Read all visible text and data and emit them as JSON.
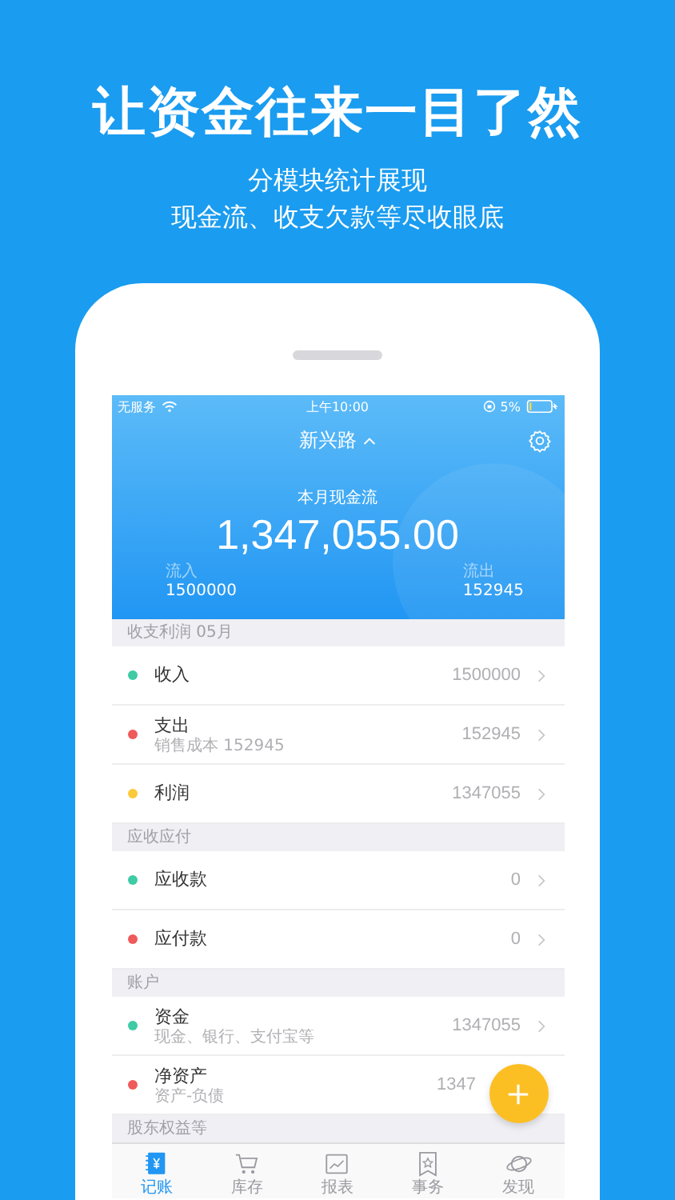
{
  "headline": "让资金往来一目了然",
  "subtitle": [
    "分模块统计展现",
    "现金流、收支欠款等尽收眼底"
  ],
  "status_bar": {
    "carrier": "无服务",
    "time": "上午10:00",
    "battery": "5%"
  },
  "header": {
    "title": "新兴路",
    "caption": "本月现金流",
    "amount": "1,347,055.00",
    "inflow": {
      "label": "流入",
      "value": "1500000"
    },
    "outflow": {
      "label": "流出",
      "value": "152945"
    }
  },
  "sections": [
    {
      "title": "收支利润 05月",
      "rows": [
        {
          "title": "收入",
          "value": "1500000",
          "color": "#3ecba5"
        },
        {
          "title": "支出",
          "subtitle": "销售成本 152945",
          "value": "152945",
          "color": "#f05a5a"
        },
        {
          "title": "利润",
          "value": "1347055",
          "color": "#fcc93a"
        }
      ]
    },
    {
      "title": "应收应付",
      "rows": [
        {
          "title": "应收款",
          "value": "0",
          "color": "#3ecba5"
        },
        {
          "title": "应付款",
          "value": "0",
          "color": "#f05a5a"
        }
      ]
    },
    {
      "title": "账户",
      "rows": [
        {
          "title": "资金",
          "subtitle": "现金、银行、支付宝等",
          "value": "1347055",
          "color": "#3ecba5"
        },
        {
          "title": "净资产",
          "subtitle": "资产-负债",
          "value": "1347",
          "color": "#f05a5a",
          "under_button": true
        }
      ]
    },
    {
      "title": "股东权益等"
    }
  ],
  "fab": {
    "kind": "add"
  },
  "tabs": [
    {
      "label": "记账",
      "selected": true
    },
    {
      "label": "库存",
      "selected": false
    },
    {
      "label": "报表",
      "selected": false
    },
    {
      "label": "事务",
      "selected": false
    },
    {
      "label": "发现",
      "selected": false
    }
  ]
}
